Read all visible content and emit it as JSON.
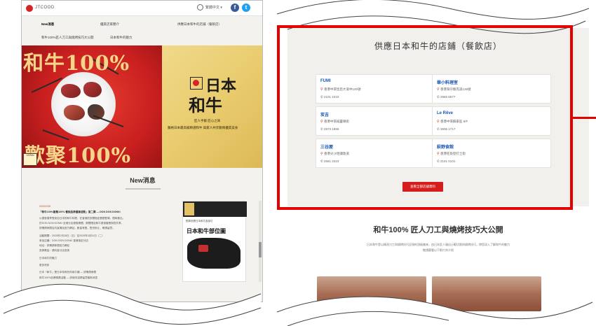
{
  "colors": {
    "accent": "#d61d1d",
    "highlight": "#e50000",
    "link": "#1a57b5"
  },
  "left": {
    "logo_text": "JTCOOD",
    "lang_label": "繁體中文 ▾",
    "nav": [
      "New消息",
      "優質店家簡介",
      "供應日本和牛的店鋪（餐飲店）",
      "和牛100%匠人刀工與燒烤技巧大公開",
      "日本和牛的魅力"
    ],
    "banner": {
      "headline_top": "和牛100%",
      "headline_bottom": "歡聚100%",
      "brand_top": "日本",
      "brand_bottom": "和牛",
      "tagline1": "匠人手藝 匠心之味",
      "tagline2": "嚴格日本最高級精選和牛 與家人共享數碼優質美食",
      "badge": "JAPAN"
    },
    "news_title": "New消息",
    "news_date": "2020/2/28",
    "news_headline": "「和牛100%歡聚100% 餐飲品牌優惠活動」第二彈 — DON DON DONKI",
    "news_lines": [
      "以優惠價享受來自日本的和牛料理，在香港的多間指定餐廳登場，限時推出。",
      "於DON DON DONKI 全港分店優惠期間，期間限定和牛優惠套餐與您共享。",
      "詳情請參閱店內宣傳及官方網站，數量有限，售完即止，敬請留意。",
      "活動期間：2020年2月28日（五）至2020年3月31日（二）",
      "參加店舖：DON DON DONKI 香港指定分店",
      "地址：詳情請參閱官方網站",
      "查詢電話：請向各分店查詢",
      "日本和牛的魅力",
      "更多資訊",
      "日本「和牛」是日本特有的肉用牛種 — 詳情請參閱",
      "和牛100%品牌推廣活動 — 詳細內容請留意最新消息"
    ],
    "side": {
      "title": "日本和牛部位圖",
      "caption": "點擊查看日本和牛各部位"
    }
  },
  "right": {
    "store_title": "供應日本和牛的店鋪（餐飲店）",
    "stores": [
      {
        "name": "FUMI",
        "address": "香港中環皇后大道中100號",
        "tel": "2101 1010"
      },
      {
        "name": "華小料理室",
        "address": "香港灣仔駱克道138號",
        "tel": "2565 6577"
      },
      {
        "name": "炭吉",
        "address": "香港中環威靈頓街",
        "tel": "2573 1855"
      },
      {
        "name": "Le Rêve",
        "address": "香港中環蘇豪區 8/F",
        "tel": "3606 1717"
      },
      {
        "name": "三谷屋",
        "address": "香港尖沙咀彌敦道",
        "tel": "2561 2323"
      },
      {
        "name": "萩野食館",
        "address": "香港旺角登打士街",
        "tel": "2101 0101"
      }
    ],
    "more_button": "查看全部店舖資料",
    "craft_title": "和牛100% 匠人刀工與燒烤技巧大公開",
    "craft_lines": [
      "日本和牛是以精湛刀工與燒烤技巧呈現的頂級美味，由日本匠人親自示範切割與燒烤技巧，帶您深入了解和牛的魅力",
      "敬請觀看以下影片與介紹"
    ]
  }
}
